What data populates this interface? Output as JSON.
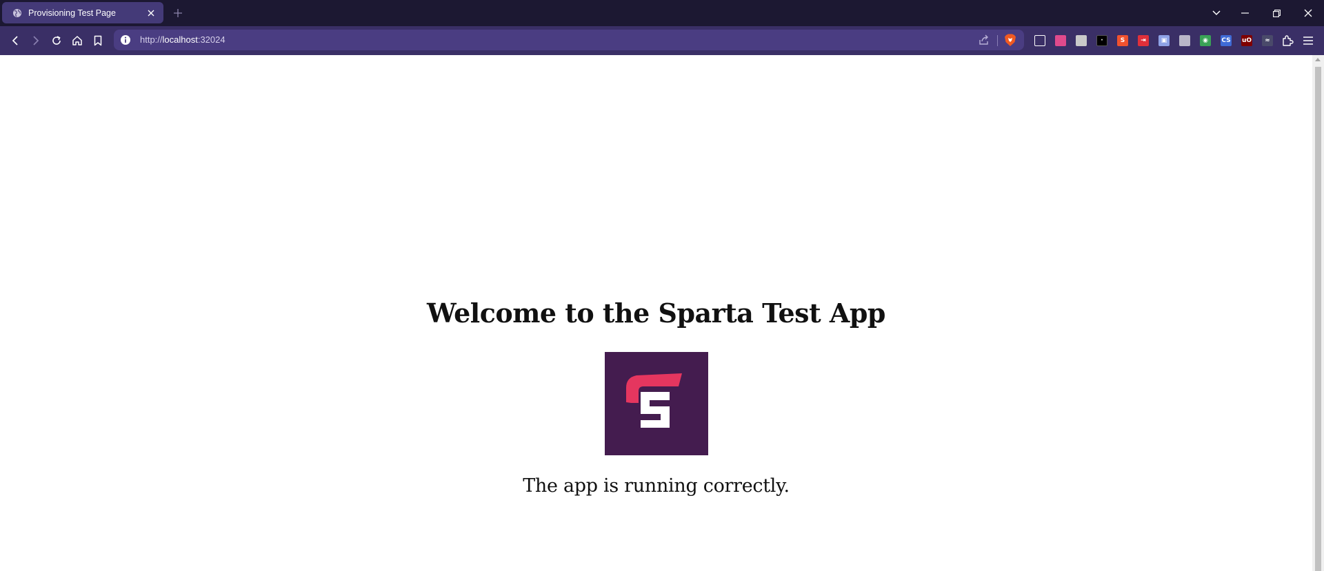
{
  "browser": {
    "tab": {
      "title": "Provisioning Test Page",
      "favicon": "globe-icon"
    },
    "new_tab_label": "+",
    "url": {
      "scheme": "http://",
      "host": "localhost",
      "port": ":32024"
    },
    "extensions": [
      {
        "name": "library-icon",
        "color": "#ffffff",
        "text": ""
      },
      {
        "name": "color-picker-extension-icon",
        "color": "#e04a8c",
        "text": ""
      },
      {
        "name": "screenshot-extension-icon",
        "color": "#c9c9c9",
        "text": ""
      },
      {
        "name": "dark-extension-icon",
        "color": "#000000",
        "text": "·"
      },
      {
        "name": "s-extension-icon",
        "color": "#f0522e",
        "text": "S"
      },
      {
        "name": "exit-extension-icon",
        "color": "#e0303a",
        "text": "⇥"
      },
      {
        "name": "translate-extension-icon",
        "color": "#8ea2e6",
        "text": "▣"
      },
      {
        "name": "shield-extension-icon",
        "color": "#b9b6c8",
        "text": ""
      },
      {
        "name": "green-extension-icon",
        "color": "#3aa356",
        "text": "◉"
      },
      {
        "name": "css-extension-icon",
        "color": "#3f6bd6",
        "text": "CS"
      },
      {
        "name": "ublock-origin-icon",
        "color": "#800000",
        "text": "uO"
      },
      {
        "name": "wave-extension-icon",
        "color": "#4a4a6a",
        "text": "≈"
      }
    ]
  },
  "page": {
    "heading": "Welcome to the Sparta Test App",
    "logo_colors": {
      "background": "#441c4f",
      "accent": "#e5365f",
      "letter": "#ffffff"
    },
    "subtext": "The app is running correctly."
  }
}
